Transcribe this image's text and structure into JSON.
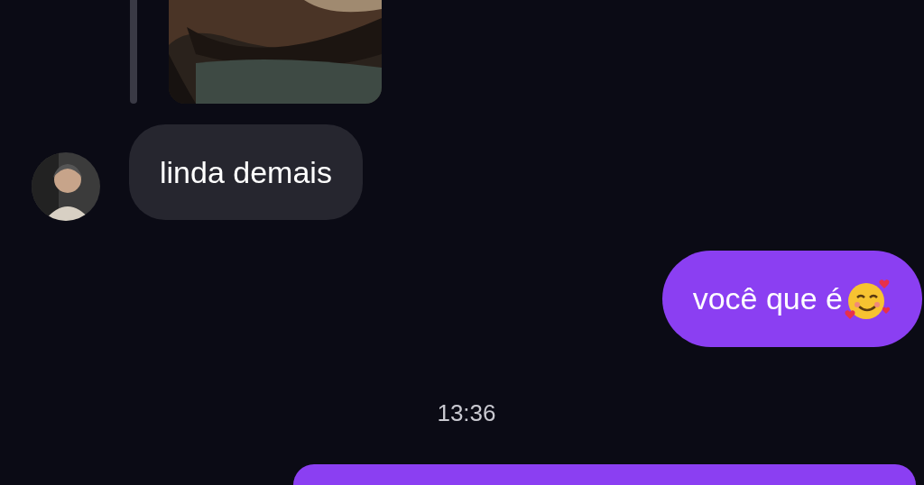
{
  "messages": [
    {
      "kind": "received",
      "text": "linda demais"
    },
    {
      "kind": "sent",
      "text": "você que é"
    },
    {
      "kind": "time",
      "text": "13:36"
    },
    {
      "kind": "sent_cut"
    }
  ]
}
